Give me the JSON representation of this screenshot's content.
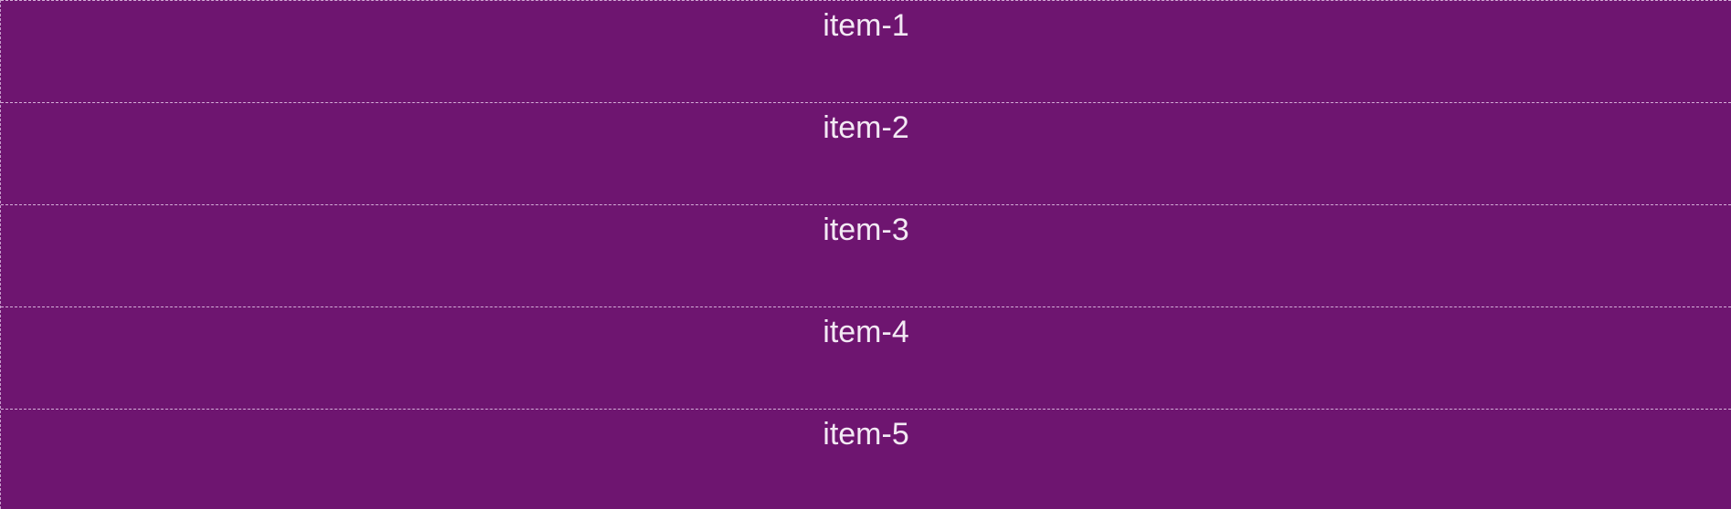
{
  "items": [
    {
      "label": "item-1"
    },
    {
      "label": "item-2"
    },
    {
      "label": "item-3"
    },
    {
      "label": "item-4"
    },
    {
      "label": "item-5"
    }
  ],
  "colors": {
    "background": "#6e1570",
    "text": "#f3e9f4",
    "divider": "#d6b0da"
  }
}
